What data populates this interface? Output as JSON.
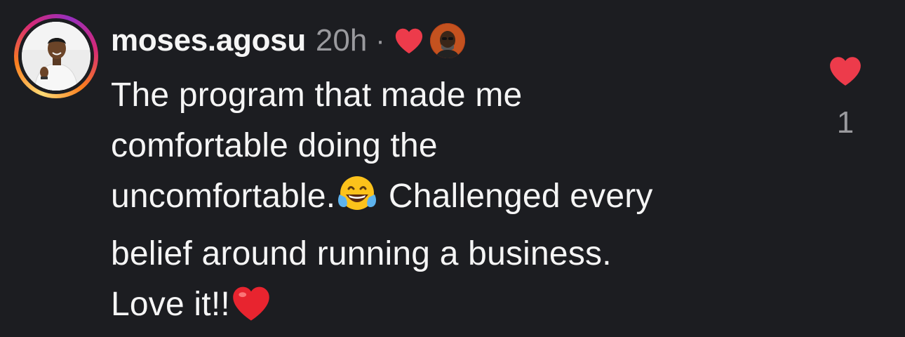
{
  "comment": {
    "username": "moses.agosu",
    "time": "20h",
    "separator": "·",
    "text_lines": [
      "The program that made me",
      "comfortable doing the",
      "uncomfortable.",
      "Challenged every",
      "belief around running a business.",
      "Love it!!"
    ],
    "emojis": {
      "laughing": "face-with-tears-of-joy",
      "heart": "red-heart"
    },
    "liked_by_creator": true,
    "like_count": "1"
  },
  "colors": {
    "background": "#1c1d21",
    "text": "#f5f5f5",
    "secondary": "#9a9a9e",
    "heart": "#ed3b4b"
  },
  "icons": {
    "like": "heart-icon",
    "creator_liked": "heart-icon"
  }
}
